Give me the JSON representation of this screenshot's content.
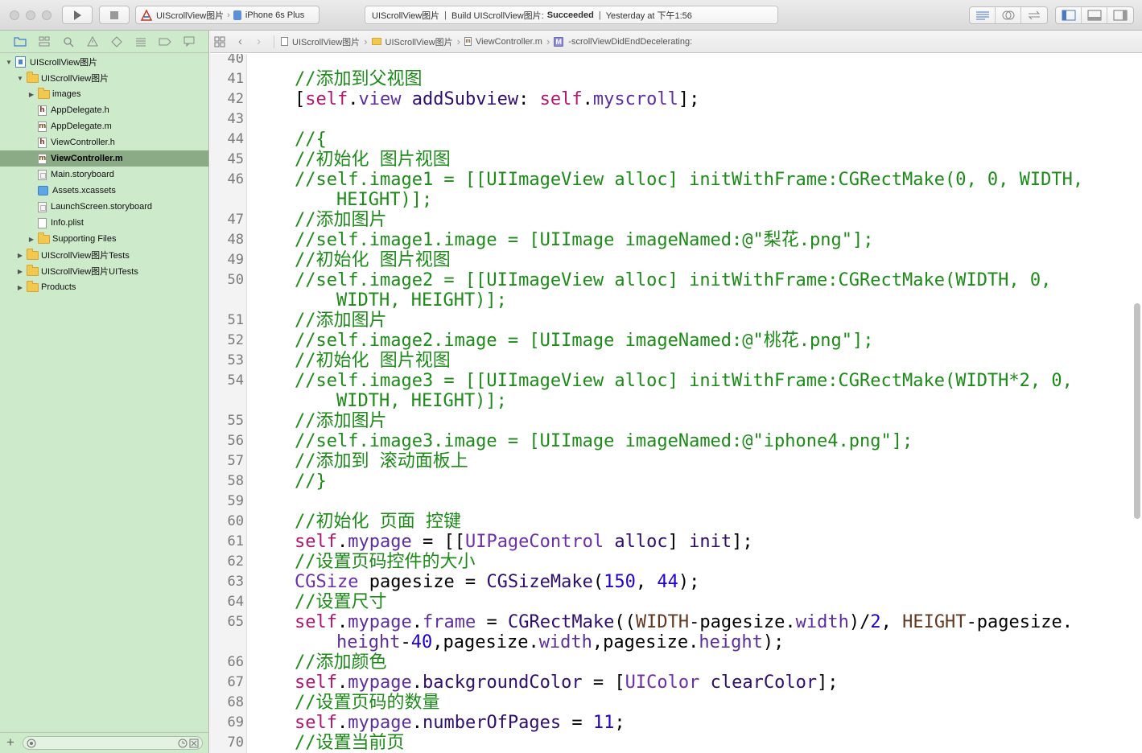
{
  "toolbar": {
    "scheme_target": "UIScrollView图片",
    "scheme_device": "iPhone 6s Plus",
    "activity_project": "UIScrollView图片",
    "activity_build": "Build UIScrollView图片:",
    "activity_status": "Succeeded",
    "activity_time": "Yesterday at 下午1:56",
    "icons": [
      "run-icon",
      "stop-icon",
      "standard-editor-icon",
      "assistant-editor-icon",
      "version-editor-icon",
      "navigator-toggle-icon",
      "debug-toggle-icon",
      "utilities-toggle-icon"
    ]
  },
  "navigator": {
    "tree": [
      {
        "label": "UIScrollView图片",
        "kind": "project",
        "depth": 0,
        "disclosure": "open"
      },
      {
        "label": "UIScrollView图片",
        "kind": "folder",
        "depth": 1,
        "disclosure": "open"
      },
      {
        "label": "images",
        "kind": "folder",
        "depth": 2,
        "disclosure": "closed"
      },
      {
        "label": "AppDelegate.h",
        "kind": "h",
        "depth": 2
      },
      {
        "label": "AppDelegate.m",
        "kind": "m",
        "depth": 2
      },
      {
        "label": "ViewController.h",
        "kind": "h",
        "depth": 2
      },
      {
        "label": "ViewController.m",
        "kind": "m",
        "depth": 2,
        "selected": true
      },
      {
        "label": "Main.storyboard",
        "kind": "storyboard",
        "depth": 2
      },
      {
        "label": "Assets.xcassets",
        "kind": "xcassets",
        "depth": 2
      },
      {
        "label": "LaunchScreen.storyboard",
        "kind": "storyboard",
        "depth": 2
      },
      {
        "label": "Info.plist",
        "kind": "plist",
        "depth": 2
      },
      {
        "label": "Supporting Files",
        "kind": "folder",
        "depth": 2,
        "disclosure": "closed"
      },
      {
        "label": "UIScrollView图片Tests",
        "kind": "folder",
        "depth": 1,
        "disclosure": "closed"
      },
      {
        "label": "UIScrollView图片UITests",
        "kind": "folder",
        "depth": 1,
        "disclosure": "closed"
      },
      {
        "label": "Products",
        "kind": "folder",
        "depth": 1,
        "disclosure": "closed"
      }
    ]
  },
  "jumpbar": {
    "project": "UIScrollView图片",
    "group": "UIScrollView图片",
    "file": "ViewController.m",
    "method": "-scrollViewDidEndDecelerating:",
    "method_badge": "M"
  },
  "editor": {
    "lines": [
      {
        "n": "40",
        "tokens": []
      },
      {
        "n": "41",
        "tokens": [
          [
            "cmt",
            "//添加到父视图"
          ]
        ]
      },
      {
        "n": "42",
        "tokens": [
          [
            "",
            "["
          ],
          [
            "kw",
            "self"
          ],
          [
            "",
            "."
          ],
          [
            "prop",
            "view"
          ],
          [
            "",
            " "
          ],
          [
            "mth",
            "addSubview"
          ],
          [
            "",
            ": "
          ],
          [
            "kw",
            "self"
          ],
          [
            "",
            "."
          ],
          [
            "prop",
            "myscroll"
          ],
          [
            "",
            "];"
          ]
        ]
      },
      {
        "n": "43",
        "tokens": []
      },
      {
        "n": "44",
        "tokens": [
          [
            "cmt",
            "//{"
          ]
        ]
      },
      {
        "n": "45",
        "tokens": [
          [
            "cmt",
            "//初始化 图片视图"
          ]
        ]
      },
      {
        "n": "46",
        "tokens": [
          [
            "cmt",
            "//self.image1 = [[UIImageView alloc] initWithFrame:CGRectMake(0, 0, WIDTH,"
          ]
        ]
      },
      {
        "n": "",
        "cont": true,
        "tokens": [
          [
            "cmt",
            "HEIGHT)];"
          ]
        ]
      },
      {
        "n": "47",
        "tokens": [
          [
            "cmt",
            "//添加图片"
          ]
        ]
      },
      {
        "n": "48",
        "tokens": [
          [
            "cmt",
            "//self.image1.image = [UIImage imageNamed:@\"梨花.png\"];"
          ]
        ]
      },
      {
        "n": "49",
        "tokens": [
          [
            "cmt",
            "//初始化 图片视图"
          ]
        ]
      },
      {
        "n": "50",
        "tokens": [
          [
            "cmt",
            "//self.image2 = [[UIImageView alloc] initWithFrame:CGRectMake(WIDTH, 0,"
          ]
        ]
      },
      {
        "n": "",
        "cont": true,
        "tokens": [
          [
            "cmt",
            "WIDTH, HEIGHT)];"
          ]
        ]
      },
      {
        "n": "51",
        "tokens": [
          [
            "cmt",
            "//添加图片"
          ]
        ]
      },
      {
        "n": "52",
        "tokens": [
          [
            "cmt",
            "//self.image2.image = [UIImage imageNamed:@\"桃花.png\"];"
          ]
        ]
      },
      {
        "n": "53",
        "tokens": [
          [
            "cmt",
            "//初始化 图片视图"
          ]
        ]
      },
      {
        "n": "54",
        "tokens": [
          [
            "cmt",
            "//self.image3 = [[UIImageView alloc] initWithFrame:CGRectMake(WIDTH*2, 0,"
          ]
        ]
      },
      {
        "n": "",
        "cont": true,
        "tokens": [
          [
            "cmt",
            "WIDTH, HEIGHT)];"
          ]
        ]
      },
      {
        "n": "55",
        "tokens": [
          [
            "cmt",
            "//添加图片"
          ]
        ]
      },
      {
        "n": "56",
        "tokens": [
          [
            "cmt",
            "//self.image3.image = [UIImage imageNamed:@\"iphone4.png\"];"
          ]
        ]
      },
      {
        "n": "57",
        "tokens": [
          [
            "cmt",
            "//添加到 滚动面板上"
          ]
        ]
      },
      {
        "n": "58",
        "tokens": [
          [
            "cmt",
            "//}"
          ]
        ]
      },
      {
        "n": "59",
        "tokens": []
      },
      {
        "n": "60",
        "tokens": [
          [
            "cmt",
            "//初始化 页面 控键"
          ]
        ]
      },
      {
        "n": "61",
        "tokens": [
          [
            "kw",
            "self"
          ],
          [
            "",
            "."
          ],
          [
            "prop",
            "mypage"
          ],
          [
            "",
            " = [["
          ],
          [
            "cls",
            "UIPageControl"
          ],
          [
            "",
            " "
          ],
          [
            "mth",
            "alloc"
          ],
          [
            "",
            "] "
          ],
          [
            "mth",
            "init"
          ],
          [
            "",
            "];"
          ]
        ]
      },
      {
        "n": "62",
        "tokens": [
          [
            "cmt",
            "//设置页码控件的大小"
          ]
        ]
      },
      {
        "n": "63",
        "tokens": [
          [
            "cls",
            "CGSize"
          ],
          [
            "",
            " pagesize = "
          ],
          [
            "mth",
            "CGSizeMake"
          ],
          [
            "",
            "("
          ],
          [
            "num",
            "150"
          ],
          [
            "",
            ", "
          ],
          [
            "num",
            "44"
          ],
          [
            "",
            ");"
          ]
        ]
      },
      {
        "n": "64",
        "tokens": [
          [
            "cmt",
            "//设置尺寸"
          ]
        ]
      },
      {
        "n": "65",
        "tokens": [
          [
            "kw",
            "self"
          ],
          [
            "",
            "."
          ],
          [
            "prop",
            "mypage"
          ],
          [
            "",
            "."
          ],
          [
            "prop",
            "frame"
          ],
          [
            "",
            " = "
          ],
          [
            "mth",
            "CGRectMake"
          ],
          [
            "",
            "(("
          ],
          [
            "mac",
            "WIDTH"
          ],
          [
            "",
            "-pagesize."
          ],
          [
            "prop",
            "width"
          ],
          [
            "",
            ")/"
          ],
          [
            "num",
            "2"
          ],
          [
            "",
            ", "
          ],
          [
            "mac",
            "HEIGHT"
          ],
          [
            "",
            "-pagesize."
          ]
        ]
      },
      {
        "n": "",
        "cont": true,
        "tokens": [
          [
            "prop",
            "height"
          ],
          [
            "",
            "-"
          ],
          [
            "num",
            "40"
          ],
          [
            "",
            ",pagesize."
          ],
          [
            "prop",
            "width"
          ],
          [
            "",
            ",pagesize."
          ],
          [
            "prop",
            "height"
          ],
          [
            "",
            ");"
          ]
        ]
      },
      {
        "n": "66",
        "tokens": [
          [
            "cmt",
            "//添加颜色"
          ]
        ]
      },
      {
        "n": "67",
        "tokens": [
          [
            "kw",
            "self"
          ],
          [
            "",
            "."
          ],
          [
            "prop",
            "mypage"
          ],
          [
            "",
            "."
          ],
          [
            "mth",
            "backgroundColor"
          ],
          [
            "",
            " = ["
          ],
          [
            "cls",
            "UIColor"
          ],
          [
            "",
            " "
          ],
          [
            "mth",
            "clearColor"
          ],
          [
            "",
            "];"
          ]
        ]
      },
      {
        "n": "68",
        "tokens": [
          [
            "cmt",
            "//设置页码的数量"
          ]
        ]
      },
      {
        "n": "69",
        "tokens": [
          [
            "kw",
            "self"
          ],
          [
            "",
            "."
          ],
          [
            "prop",
            "mypage"
          ],
          [
            "",
            "."
          ],
          [
            "mth",
            "numberOfPages"
          ],
          [
            "",
            " = "
          ],
          [
            "num",
            "11"
          ],
          [
            "",
            ";"
          ]
        ]
      },
      {
        "n": "70",
        "tokens": [
          [
            "cmt",
            "//设置当前页"
          ]
        ]
      }
    ]
  }
}
